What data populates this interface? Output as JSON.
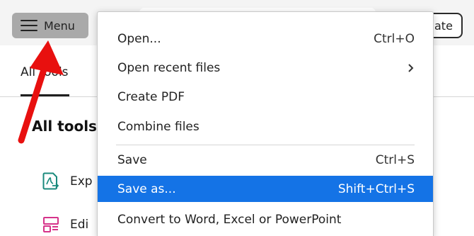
{
  "toolbar": {
    "menu_label": "Menu",
    "partial_button_label": "ate"
  },
  "panel": {
    "tab_label": "All tools",
    "section_title": "All tools",
    "tools": [
      {
        "label": "Exp",
        "icon": "export-pdf-icon",
        "color": "#1a8a7c"
      },
      {
        "label": "Edi",
        "icon": "edit-pdf-icon",
        "color": "#d6338a"
      }
    ]
  },
  "menu": {
    "items": [
      {
        "label": "Open...",
        "shortcut": "Ctrl+O"
      },
      {
        "label": "Open recent files",
        "submenu": true
      },
      {
        "label": "Create PDF"
      },
      {
        "label": "Combine files"
      },
      {
        "label": "Save",
        "shortcut": "Ctrl+S"
      },
      {
        "label": "Save as...",
        "shortcut": "Shift+Ctrl+S",
        "selected": true
      },
      {
        "label": "Convert to Word, Excel or PowerPoint"
      }
    ]
  },
  "colors": {
    "selection": "#1473e6",
    "annotation_arrow": "#e8100f",
    "menu_button_bg": "#a9a9a9"
  }
}
